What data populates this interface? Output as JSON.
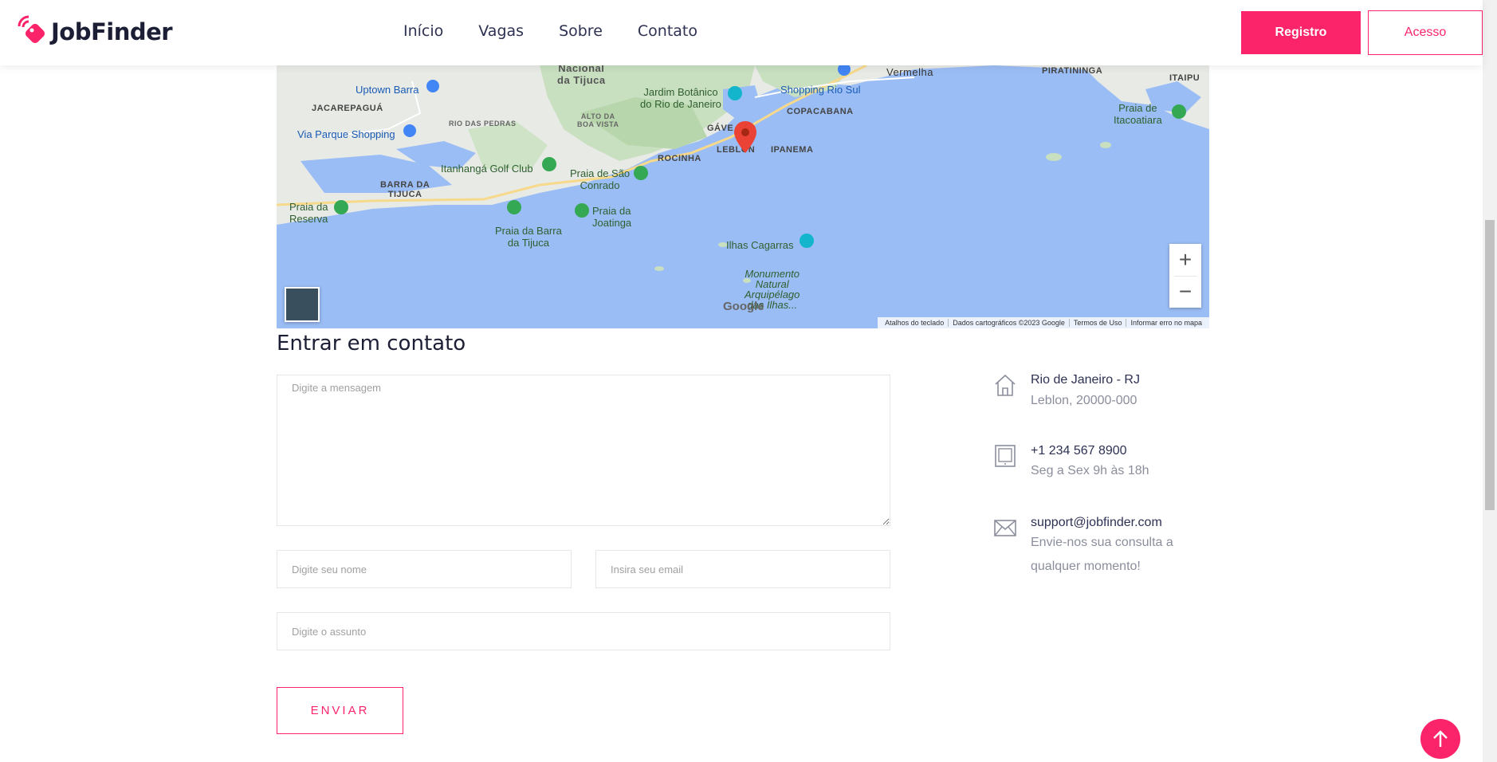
{
  "header": {
    "brand": "JobFinder",
    "nav": [
      "Início",
      "Vagas",
      "Sobre",
      "Contato"
    ],
    "register_label": "Registro",
    "login_label": "Acesso"
  },
  "map": {
    "labels": {
      "nacional": "Nacional\nda Tijuca",
      "vermelha": "Vermelha",
      "piratininga": "PIRATININGA",
      "itaipu": "ITAIPU",
      "uptown": "Uptown Barra",
      "jardim": "Jardim Botânico\ndo Rio de Janeiro",
      "shopping_rio_sul": "Shopping Rio Sul",
      "jacarepagua": "JACAREPAGUÁ",
      "rio_das_pedras": "RIO DAS PEDRAS",
      "alto_boa_vista": "ALTO DA\nBOA VISTA",
      "copacabana": "COPACABANA",
      "gavea": "GÁVE",
      "leblon": "LEBLON",
      "ipanema": "IPANEMA",
      "itacoatiara": "Praia de\nItacoatiara",
      "via_parque": "Via Parque Shopping",
      "rocinha": "ROCINHA",
      "itanhanga": "Itanhangá Golf Club",
      "sao_conrado": "Praia de São\nConrado",
      "barra_tijuca": "BARRA DA\nTIJUCA",
      "reserva": "Praia da\nReserva",
      "joatinga": "Praia da\nJoatinga",
      "barra_praia": "Praia da Barra\nda Tijuca",
      "cagarras": "Ilhas Cagarras",
      "monumento": "Monumento\nNatural\nArquipélago\ndas Ilhas..."
    },
    "google": "Google",
    "attribution": [
      "Atalhos do teclado",
      "Dados cartográficos ©2023 Google",
      "Termos de Uso",
      "Informar erro no mapa"
    ],
    "zoom_in": "+",
    "zoom_out": "−"
  },
  "contact": {
    "title": "Entrar em contato",
    "message_placeholder": "Digite a mensagem",
    "name_placeholder": "Digite seu nome",
    "email_placeholder": "Insira seu email",
    "subject_placeholder": "Digite o assunto",
    "send_label": "ENVIAR"
  },
  "info": {
    "address_title": "Rio de Janeiro - RJ",
    "address_sub": "Leblon, 20000-000",
    "phone_title": "+1 234 567 8900",
    "phone_sub": "Seg a Sex 9h às 18h",
    "email_title": "support@jobfinder.com",
    "email_sub": "Envie-nos sua consulta a qualquer momento!"
  },
  "colors": {
    "accent": "#fb246a",
    "text_dark": "#1b1e34",
    "muted": "#8b8e9c"
  }
}
